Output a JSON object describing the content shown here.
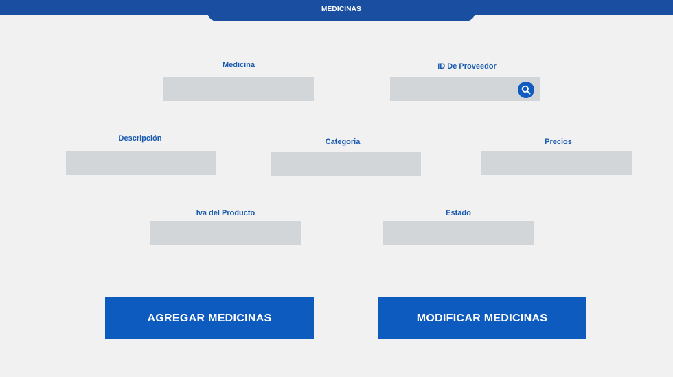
{
  "header": {
    "title": "MEDICINAS"
  },
  "form": {
    "medicina": {
      "label": "Medicina",
      "value": ""
    },
    "id_proveedor": {
      "label": "ID De Proveedor",
      "value": ""
    },
    "descripcion": {
      "label": "Descripción",
      "value": ""
    },
    "categoria": {
      "label": "Categoria",
      "value": ""
    },
    "precios": {
      "label": "Precios",
      "value": ""
    },
    "iva": {
      "label": "Iva del Producto",
      "value": ""
    },
    "estado": {
      "label": "Estado",
      "value": ""
    }
  },
  "actions": {
    "agregar_label": "AGREGAR MEDICINAS",
    "modificar_label": "MODIFICAR MEDICINAS"
  },
  "icons": {
    "search": "search-icon"
  },
  "colors": {
    "header_bg": "#1a4ea0",
    "label_text": "#1a5bb0",
    "input_bg": "#d2d6d9",
    "button_bg": "#0e5bbf",
    "page_bg": "#f1f1f1"
  }
}
